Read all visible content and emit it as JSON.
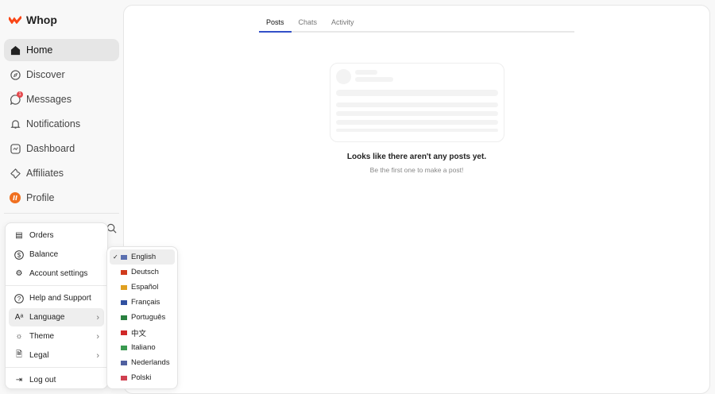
{
  "brand": {
    "name": "Whop",
    "color": "#fa4616"
  },
  "nav": [
    {
      "label": "Home",
      "icon": "home-icon",
      "active": true
    },
    {
      "label": "Discover",
      "icon": "compass-icon"
    },
    {
      "label": "Messages",
      "icon": "message-icon",
      "badge": "1"
    },
    {
      "label": "Notifications",
      "icon": "bell-icon"
    },
    {
      "label": "Dashboard",
      "icon": "dashboard-icon"
    },
    {
      "label": "Affiliates",
      "icon": "ticket-icon"
    },
    {
      "label": "Profile",
      "icon": "avatar-icon"
    }
  ],
  "tabs": [
    {
      "label": "Posts",
      "active": true
    },
    {
      "label": "Chats"
    },
    {
      "label": "Activity"
    }
  ],
  "empty": {
    "title": "Looks like there aren't any posts yet.",
    "subtitle": "Be the first one to make a post!"
  },
  "menu": {
    "items": [
      "Orders",
      "Balance",
      "Account settings",
      "Help and Support",
      "Language",
      "Theme",
      "Legal",
      "Log out"
    ]
  },
  "languages": [
    {
      "label": "English",
      "selected": true,
      "flag": "#5a6fb0"
    },
    {
      "label": "Deutsch",
      "flag": "#d03a1c"
    },
    {
      "label": "Español",
      "flag": "#e0a020"
    },
    {
      "label": "Français",
      "flag": "#3050a0"
    },
    {
      "label": "Português",
      "flag": "#2a8040"
    },
    {
      "label": "中文",
      "flag": "#d02828"
    },
    {
      "label": "Italiano",
      "flag": "#3a9a50"
    },
    {
      "label": "Nederlands",
      "flag": "#5060a0"
    },
    {
      "label": "Polski",
      "flag": "#d04050"
    }
  ],
  "check": "✓"
}
